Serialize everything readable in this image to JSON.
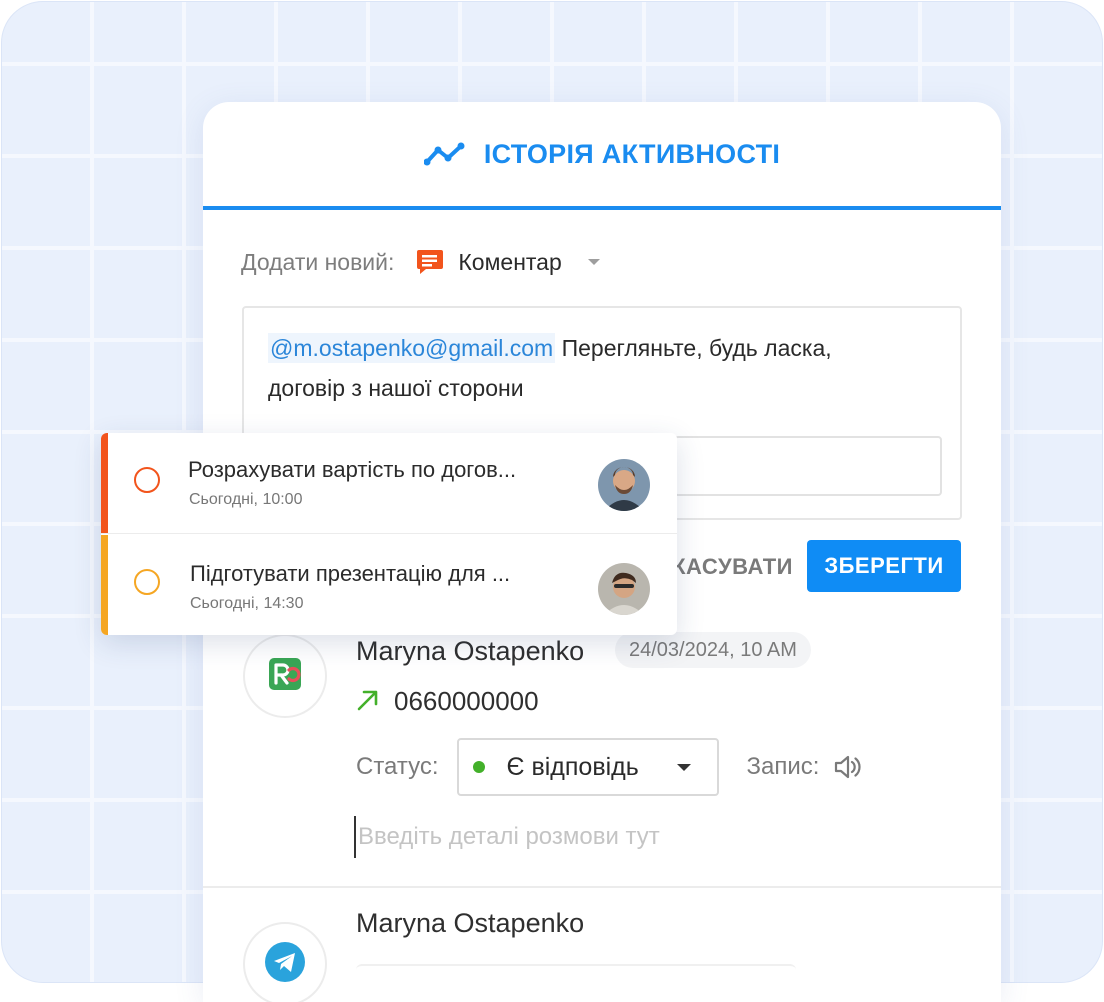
{
  "colors": {
    "accent": "#1a8cf0",
    "save_button": "#0f8cf5",
    "task1_bar": "#f2541c",
    "task2_bar": "#f5a623",
    "status_dot": "#43b02a"
  },
  "header": {
    "title": "ІСТОРІЯ АКТИВНОСТІ",
    "icon": "activity-chart-icon"
  },
  "composer": {
    "add_label": "Додати новий:",
    "type_icon": "comment-icon",
    "type_value": "Коментар",
    "mention": "@m.ostapenko@gmail.com",
    "text_line1": "Перегляньте, будь ласка,",
    "text_line2": "договір з нашої сторони",
    "cancel_label": "СКАСУВАТИ",
    "save_label": "ЗБЕРЕГТИ"
  },
  "tasks": [
    {
      "title": "Розрахувати вартість по догов...",
      "time": "Сьогодні, 10:00"
    },
    {
      "title": "Підготувати презентацію для ...",
      "time": "Сьогодні, 14:30"
    }
  ],
  "activity": {
    "call": {
      "author": "Maryna Ostapenko",
      "date": "24/03/2024, 10 AM",
      "phone": "0660000000",
      "status_label": "Статус:",
      "status_value": "Є відповідь",
      "record_label": "Запис:",
      "details_placeholder": "Введіть деталі розмови тут"
    },
    "telegram": {
      "author": "Maryna Ostapenko"
    }
  }
}
